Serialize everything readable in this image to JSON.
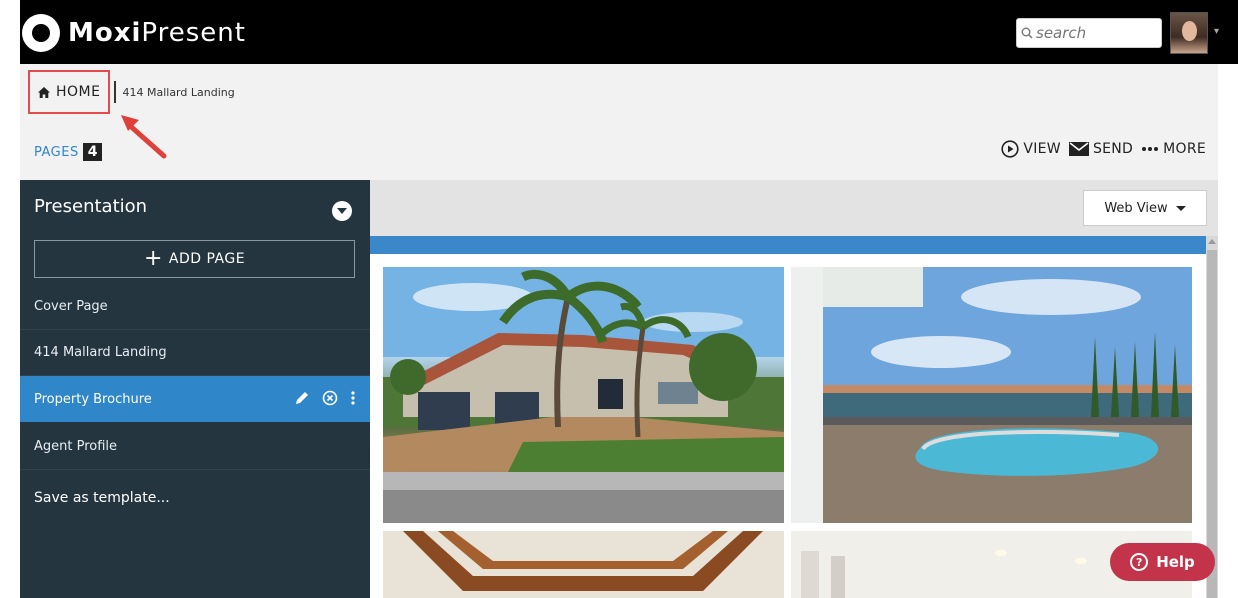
{
  "app": {
    "logo_bold": "Moxi",
    "logo_light": "Present"
  },
  "search": {
    "placeholder": "search"
  },
  "breadcrumb": {
    "home_label": "HOME",
    "current": "414 Mallard Landing"
  },
  "pages": {
    "label": "PAGES",
    "count": "4"
  },
  "actions": {
    "view": "VIEW",
    "send": "SEND",
    "more": "MORE"
  },
  "sidebar": {
    "title": "Presentation",
    "add_page": "ADD PAGE",
    "items": [
      {
        "label": "Cover Page"
      },
      {
        "label": "414 Mallard Landing"
      },
      {
        "label": "Property Brochure"
      },
      {
        "label": "Agent Profile"
      }
    ],
    "save_template": "Save as template..."
  },
  "content": {
    "view_select": "Web View"
  },
  "help": {
    "label": "Help"
  },
  "colors": {
    "accent": "#2f86c9",
    "sidebar_bg": "#243540",
    "help_bg": "#c3344a",
    "highlight": "#e34c4c"
  }
}
